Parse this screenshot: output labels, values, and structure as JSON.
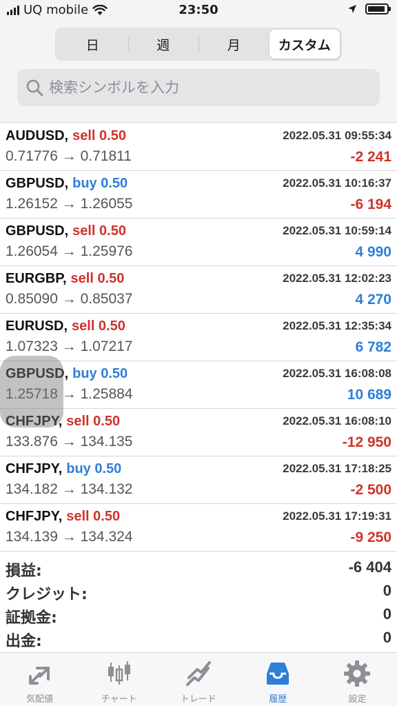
{
  "status": {
    "carrier": "UQ mobile",
    "time": "23:50"
  },
  "tabs_period": [
    {
      "label": "日",
      "active": false
    },
    {
      "label": "週",
      "active": false
    },
    {
      "label": "月",
      "active": false
    },
    {
      "label": "カスタム",
      "active": true
    }
  ],
  "search": {
    "placeholder": "検索シンボルを入力",
    "value": ""
  },
  "deals": [
    {
      "symbol": "AUDUSD,",
      "side": "sell 0.50",
      "side_type": "sell",
      "date": "2022.05.31 09:55:34",
      "prices": "0.71776 → 0.71811",
      "profit": "-2 241",
      "profit_sign": "neg"
    },
    {
      "symbol": "GBPUSD,",
      "side": "buy 0.50",
      "side_type": "buy",
      "date": "2022.05.31 10:16:37",
      "prices": "1.26152 → 1.26055",
      "profit": "-6 194",
      "profit_sign": "neg"
    },
    {
      "symbol": "GBPUSD,",
      "side": "sell 0.50",
      "side_type": "sell",
      "date": "2022.05.31 10:59:14",
      "prices": "1.26054 → 1.25976",
      "profit": "4 990",
      "profit_sign": "pos"
    },
    {
      "symbol": "EURGBP,",
      "side": "sell 0.50",
      "side_type": "sell",
      "date": "2022.05.31 12:02:23",
      "prices": "0.85090 → 0.85037",
      "profit": "4 270",
      "profit_sign": "pos"
    },
    {
      "symbol": "EURUSD,",
      "side": "sell 0.50",
      "side_type": "sell",
      "date": "2022.05.31 12:35:34",
      "prices": "1.07323 → 1.07217",
      "profit": "6 782",
      "profit_sign": "pos"
    },
    {
      "symbol": "GBPUSD,",
      "side": "buy 0.50",
      "side_type": "buy",
      "date": "2022.05.31 16:08:08",
      "prices": "1.25718 → 1.25884",
      "profit": "10 689",
      "profit_sign": "pos"
    },
    {
      "symbol": "CHFJPY,",
      "side": "sell 0.50",
      "side_type": "sell",
      "date": "2022.05.31 16:08:10",
      "prices": "133.876 → 134.135",
      "profit": "-12 950",
      "profit_sign": "neg"
    },
    {
      "symbol": "CHFJPY,",
      "side": "buy 0.50",
      "side_type": "buy",
      "date": "2022.05.31 17:18:25",
      "prices": "134.182 → 134.132",
      "profit": "-2 500",
      "profit_sign": "neg"
    },
    {
      "symbol": "CHFJPY,",
      "side": "sell 0.50",
      "side_type": "sell",
      "date": "2022.05.31 17:19:31",
      "prices": "134.139 → 134.324",
      "profit": "-9 250",
      "profit_sign": "neg"
    }
  ],
  "summary": [
    {
      "label": "損益:",
      "value": "-6 404"
    },
    {
      "label": "クレジット:",
      "value": "0"
    },
    {
      "label": "証拠金:",
      "value": "0"
    },
    {
      "label": "出金:",
      "value": "0"
    }
  ],
  "tabbar": [
    {
      "label": "気配値",
      "icon": "quotes-icon",
      "active": false
    },
    {
      "label": "チャート",
      "icon": "chart-icon",
      "active": false
    },
    {
      "label": "トレード",
      "icon": "trade-icon",
      "active": false
    },
    {
      "label": "履歴",
      "icon": "history-icon",
      "active": true
    },
    {
      "label": "設定",
      "icon": "settings-icon",
      "active": false
    }
  ],
  "colors": {
    "sell": "#d0322b",
    "buy": "#2f7ed8",
    "active_tab": "#2f7ed8",
    "inactive_tab": "#8e8e93"
  }
}
